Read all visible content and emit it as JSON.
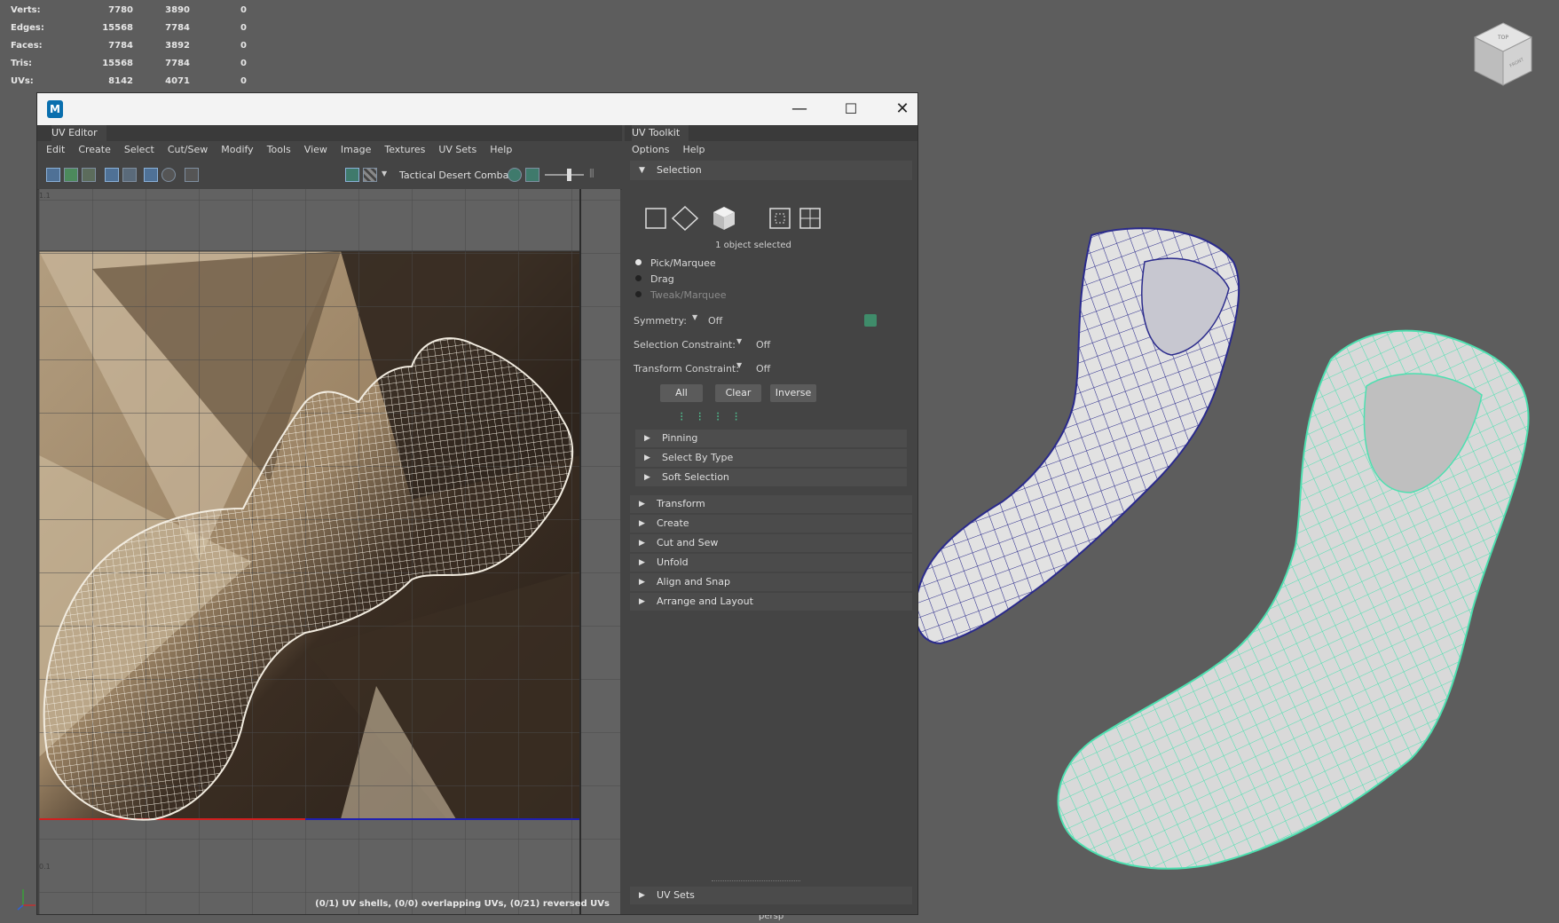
{
  "hud": {
    "rows": [
      {
        "label": "Verts:",
        "a": "7780",
        "b": "3890",
        "c": "0"
      },
      {
        "label": "Edges:",
        "a": "15568",
        "b": "7784",
        "c": "0"
      },
      {
        "label": "Faces:",
        "a": "7784",
        "b": "3892",
        "c": "0"
      },
      {
        "label": "Tris:",
        "a": "15568",
        "b": "7784",
        "c": "0"
      },
      {
        "label": "UVs:",
        "a": "8142",
        "b": "4071",
        "c": "0"
      }
    ]
  },
  "window": {
    "app_icon": "M",
    "minimize": "—",
    "maximize": "☐",
    "close": "✕"
  },
  "uv_editor": {
    "tab": "UV Editor",
    "menu": [
      "Edit",
      "Create",
      "Select",
      "Cut/Sew",
      "Modify",
      "Tools",
      "View",
      "Image",
      "Textures",
      "UV Sets",
      "Help"
    ],
    "texture_name": "Tactical Desert Comba",
    "axis_top": "1.1",
    "axis_bottom": "0.1",
    "status": "(0/1) UV shells, (0/0) overlapping UVs, (0/21) reversed UVs"
  },
  "toolkit": {
    "tab": "UV Toolkit",
    "menu": [
      "Options",
      "Help"
    ],
    "selection_header": "Selection",
    "selected_info": "1 object selected",
    "modes": [
      "Pick/Marquee",
      "Drag",
      "Tweak/Marquee"
    ],
    "symmetry_label": "Symmetry:",
    "symmetry_value": "Off",
    "sel_constraint_label": "Selection Constraint:",
    "sel_constraint_value": "Off",
    "xform_constraint_label": "Transform Constraint:",
    "xform_constraint_value": "Off",
    "btn_all": "All",
    "btn_clear": "Clear",
    "btn_inverse": "Inverse",
    "subsections": [
      "Pinning",
      "Select By Type",
      "Soft Selection"
    ],
    "sections": [
      "Transform",
      "Create",
      "Cut and Sew",
      "Unfold",
      "Align and Snap",
      "Arrange and Layout"
    ],
    "uv_sets": "UV Sets"
  },
  "viewport": {
    "camera_label": "persp",
    "cube_top": "TOP",
    "cube_side": "FRONT"
  },
  "colors": {
    "boot1_wire": "#2a2a8c",
    "boot2_wire": "#4de0b0",
    "uv_wire": "#f2ece0"
  }
}
